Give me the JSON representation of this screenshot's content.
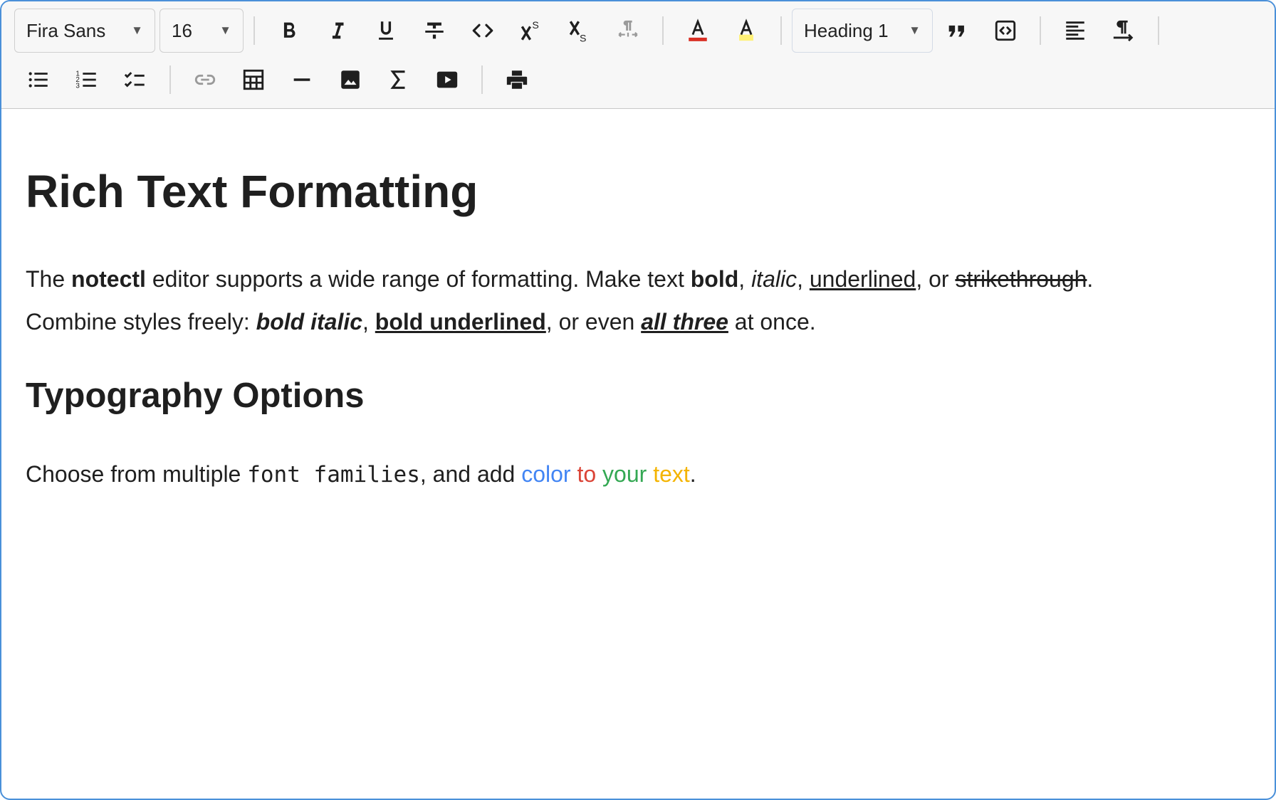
{
  "toolbar": {
    "font_family": "Fira Sans",
    "font_size": "16",
    "block_type": "Heading 1",
    "font_color_swatch": "#d93025",
    "highlight_swatch": "#fff176",
    "icons": [
      "bold-icon",
      "italic-icon",
      "underline-icon",
      "strikethrough-icon",
      "code-icon",
      "superscript-icon",
      "subscript-icon",
      "text-direction-icon",
      "font-color-icon",
      "highlight-icon",
      "blockquote-icon",
      "code-block-icon",
      "align-left-icon",
      "paragraph-direction-icon",
      "bullet-list-icon",
      "numbered-list-icon",
      "checklist-icon",
      "link-icon",
      "table-icon",
      "horizontal-rule-icon",
      "image-icon",
      "sigma-icon",
      "video-icon",
      "print-icon"
    ]
  },
  "content": {
    "heading1": "Rich Text Formatting",
    "p1": {
      "t1": "The ",
      "b1": "notectl",
      "t2": " editor supports a wide range of formatting. Make text ",
      "b2": "bold",
      "t3": ", ",
      "i1": "italic",
      "t4": ", ",
      "u1": "underlined",
      "t5": ", or ",
      "s1": "strikethrough",
      "t6": "."
    },
    "p2": {
      "t1": "Combine styles freely: ",
      "bi": "bold italic",
      "t2": ", ",
      "bu": "bold underlined",
      "t3": ", or even ",
      "all": "all three",
      "t4": " at once."
    },
    "heading2": "Typography Options",
    "p3": {
      "t1": "Choose from multiple ",
      "mono": "font families",
      "t2": ", and add ",
      "c1": "color",
      "c2": "to",
      "c3": "your",
      "c4": "text",
      "t3": "."
    },
    "colors": {
      "blue": "#4285f4",
      "red": "#db4437",
      "green": "#34a853",
      "yellow": "#f4b400"
    }
  }
}
